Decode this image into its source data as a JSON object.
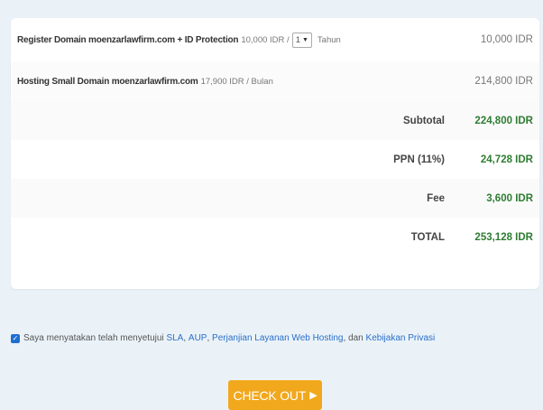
{
  "cart": {
    "items": [
      {
        "name": "Register Domain moenzarlawfirm.com + ID Protection",
        "unit_price": "10,000 IDR /",
        "qty": "1",
        "period": "Tahun",
        "total": "10,000 IDR"
      },
      {
        "name": "Hosting Small Domain moenzarlawfirm.com",
        "unit_price": "17,900 IDR / Bulan",
        "total": "214,800 IDR"
      }
    ],
    "summary": [
      {
        "label": "Subtotal",
        "value": "224,800 IDR"
      },
      {
        "label": "PPN (11%)",
        "value": "24,728 IDR"
      },
      {
        "label": "Fee",
        "value": "3,600 IDR"
      },
      {
        "label": "TOTAL",
        "value": "253,128 IDR"
      }
    ]
  },
  "agreement": {
    "prefix": "Saya menyatakan telah menyetujui",
    "sla": "SLA",
    "aup": "AUP",
    "perjanjian": "Perjanjian Layanan Web Hosting",
    "dan": "dan",
    "kebijakan": "Kebijakan Privasi",
    "comma": ","
  },
  "checkout": {
    "label": "CHECK OUT"
  },
  "colors": {
    "accent": "#f2a81d",
    "link": "#2a6fc9",
    "value_green": "#2e7d32"
  },
  "icons": {
    "checkbox": "checkmark-icon",
    "checkout_arrow": "triangle-right-icon",
    "select_caret": "chevron-down-icon"
  }
}
